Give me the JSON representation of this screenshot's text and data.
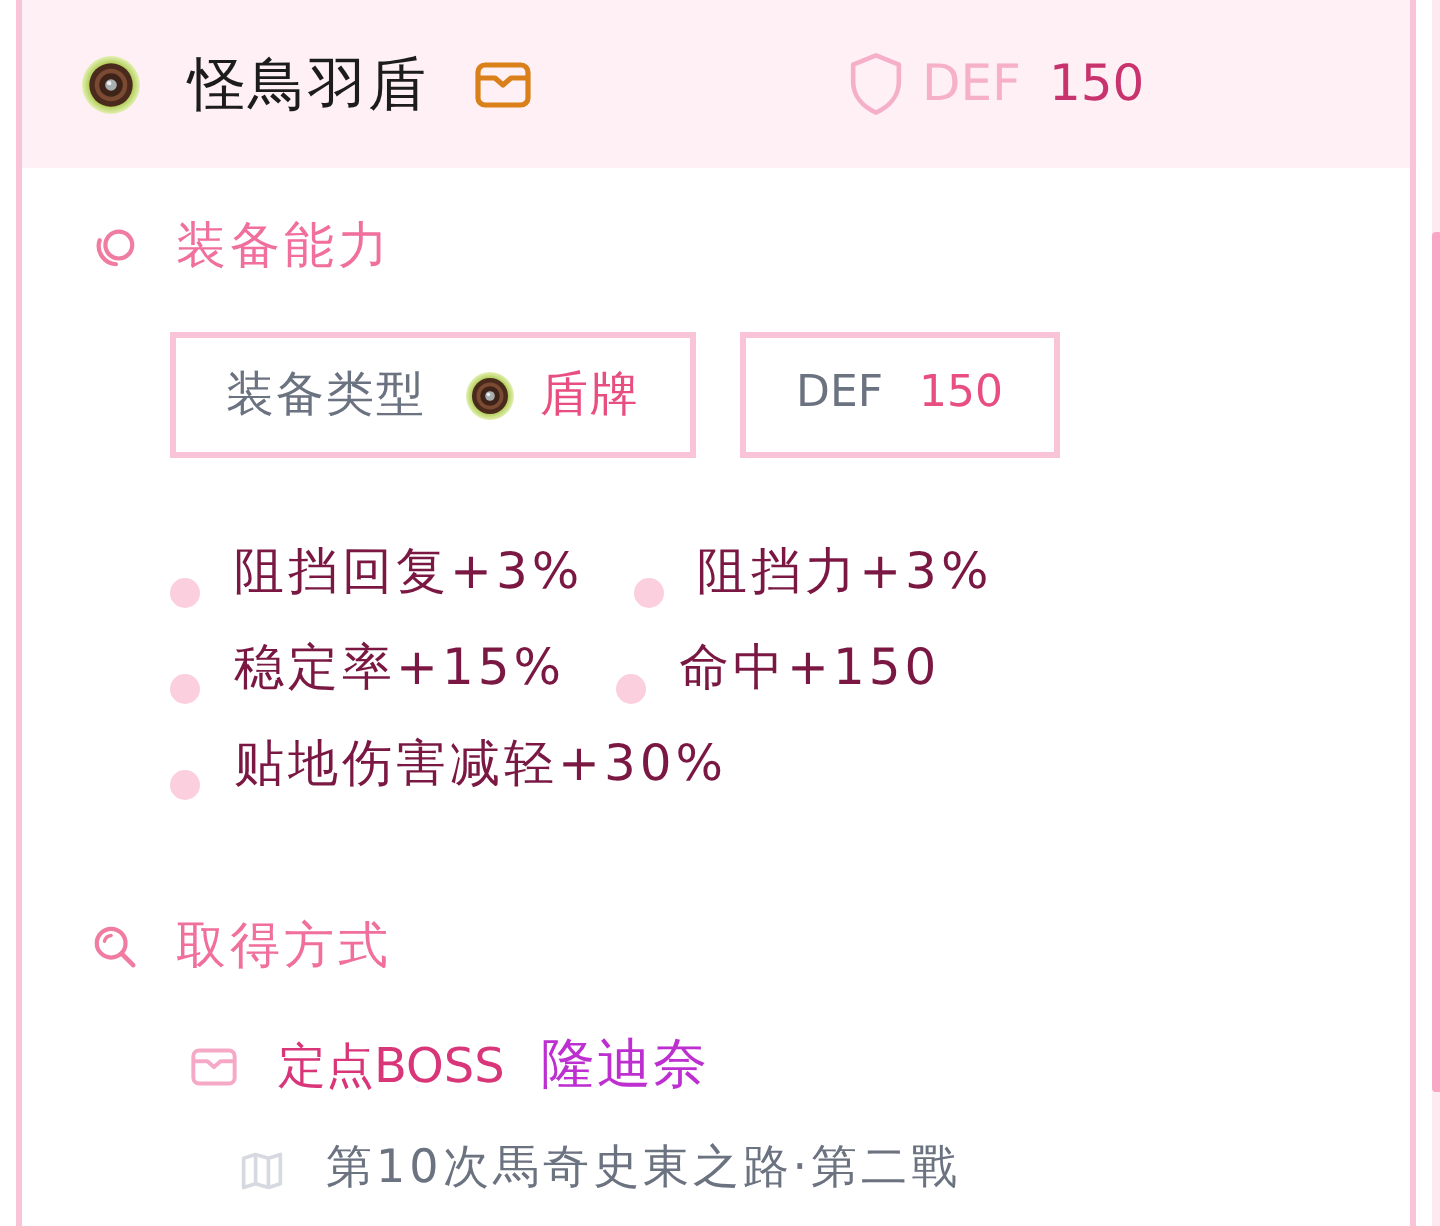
{
  "header": {
    "name": "怪鳥羽盾",
    "stat_label": "DEF",
    "stat_value": "150"
  },
  "abilities": {
    "title": "装备能力",
    "type_label": "装备类型",
    "type_value": "盾牌",
    "stat_label": "DEF",
    "stat_value": "150",
    "effects": [
      "阻挡回复+3%",
      "阻挡力+3%",
      "稳定率+15%",
      "命中+150",
      "贴地伤害减轻+30%"
    ]
  },
  "acquisition": {
    "title": "取得方式",
    "sources": [
      {
        "category": "定点BOSS",
        "boss": "隆迪奈",
        "location": "第10次馬奇史東之路·第二戰"
      }
    ]
  }
}
